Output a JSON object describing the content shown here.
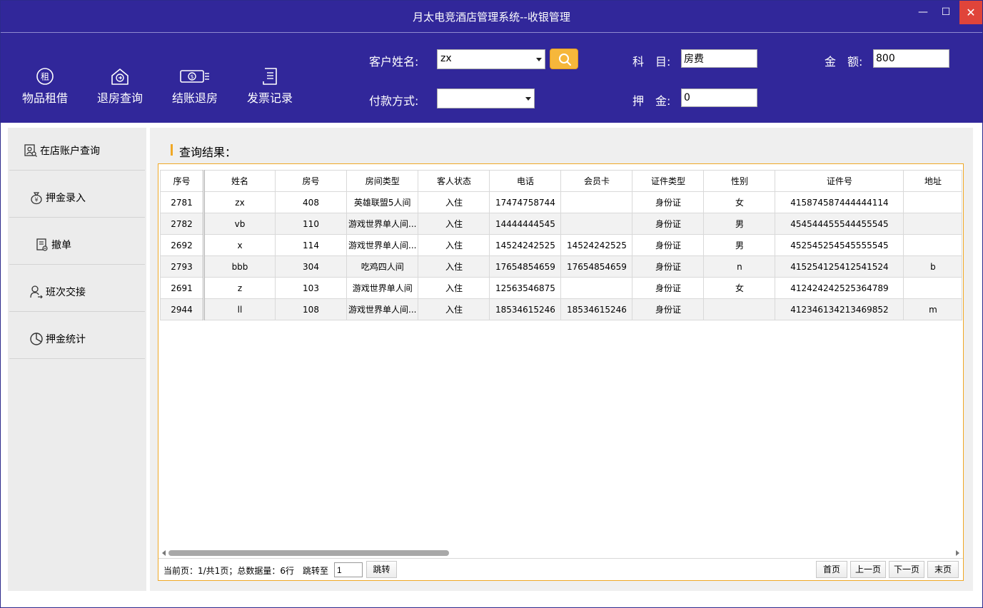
{
  "window": {
    "title": "月太电竞酒店管理系统--收银管理",
    "minimize_glyph": "—",
    "maximize_glyph": "☐",
    "close_glyph": "✕"
  },
  "nav": [
    {
      "label": "物品租借",
      "icon": "rent-icon"
    },
    {
      "label": "退房查询",
      "icon": "house-return-icon"
    },
    {
      "label": "结账退房",
      "icon": "cash-icon"
    },
    {
      "label": "发票记录",
      "icon": "receipt-icon"
    }
  ],
  "form": {
    "customer_label": "客户姓名:",
    "customer_value": "zx",
    "payment_label": "付款方式:",
    "payment_value": "",
    "subject_label": "科　目:",
    "subject_value": "房费",
    "deposit_label": "押　金:",
    "deposit_value": "0",
    "amount_label": "金　额:",
    "amount_value": "800"
  },
  "sidebar": {
    "items": [
      {
        "label": "在店账户查询",
        "icon": "account-search-icon"
      },
      {
        "label": "押金录入",
        "icon": "money-bag-icon"
      },
      {
        "label": "撤单",
        "icon": "cancel-order-icon"
      },
      {
        "label": "班次交接",
        "icon": "shift-handover-icon"
      },
      {
        "label": "押金统计",
        "icon": "pie-chart-icon"
      }
    ]
  },
  "results": {
    "title": "查询结果：",
    "columns": [
      "序号",
      "姓名",
      "房号",
      "房间类型",
      "客人状态",
      "电话",
      "会员卡",
      "证件类型",
      "性别",
      "证件号",
      "地址"
    ],
    "rows": [
      [
        "2781",
        "zx",
        "408",
        "英雄联盟5人间",
        "入住",
        "17474758744",
        "",
        "身份证",
        "女",
        "415874587444444114",
        ""
      ],
      [
        "2782",
        "vb",
        "110",
        "游戏世界单人间...",
        "入住",
        "14444444545",
        "",
        "身份证",
        "男",
        "454544455544455545",
        ""
      ],
      [
        "2692",
        "x",
        "114",
        "游戏世界单人间...",
        "入住",
        "14524242525",
        "14524242525",
        "身份证",
        "男",
        "452545254545555545",
        ""
      ],
      [
        "2793",
        "bbb",
        "304",
        "吃鸡四人间",
        "入住",
        "17654854659",
        "17654854659",
        "身份证",
        "n",
        "415254125412541524",
        "b"
      ],
      [
        "2691",
        "z",
        "103",
        "游戏世界单人间",
        "入住",
        "12563546875",
        "",
        "身份证",
        "女",
        "412424242525364789",
        ""
      ],
      [
        "2944",
        "ll",
        "108",
        "游戏世界单人间...",
        "入住",
        "18534615246",
        "18534615246",
        "身份证",
        "",
        "412346134213469852",
        "m"
      ]
    ]
  },
  "pager": {
    "info": "当前页：1/共1页；总数据量：6行",
    "jump_label": "跳转至",
    "jump_value": "1",
    "jump_button": "跳转",
    "first": "首页",
    "prev": "上一页",
    "next": "下一页",
    "last": "末页"
  },
  "colors": {
    "header": "#31279a",
    "accent": "#f0a825",
    "close": "#e0443a"
  }
}
